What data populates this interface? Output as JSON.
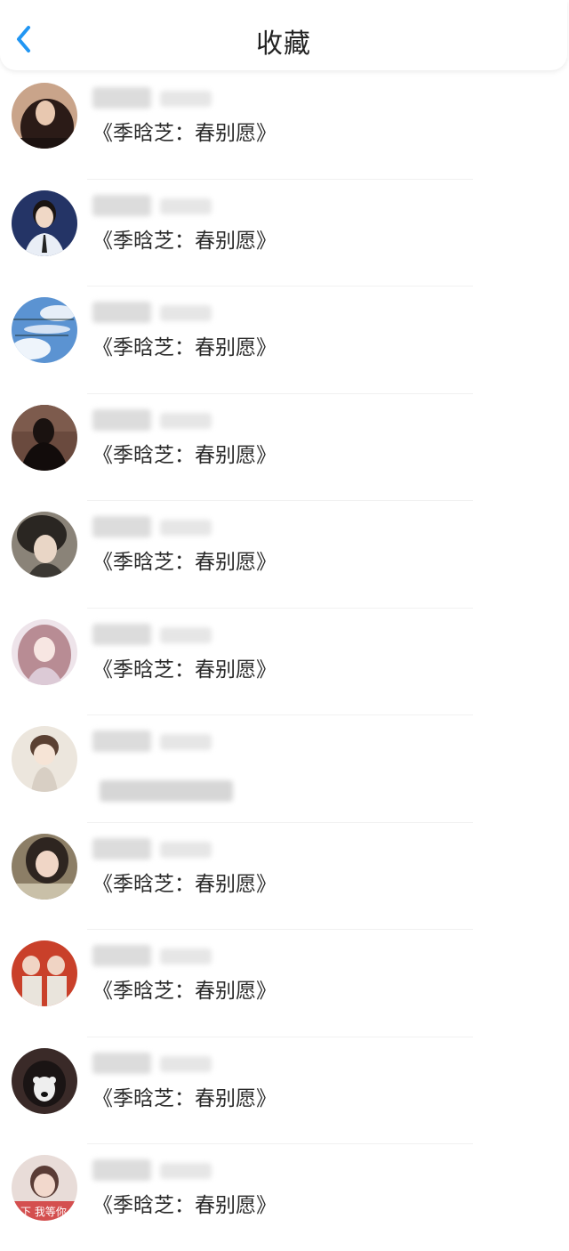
{
  "header": {
    "title": "收藏",
    "back_icon": "chevron-left-icon",
    "accent": "#2196f3"
  },
  "favorites": [
    {
      "work": "《季晗芝：春别愿》"
    },
    {
      "work": "《季晗芝：春别愿》"
    },
    {
      "work": "《季晗芝：春别愿》"
    },
    {
      "work": "《季晗芝：春别愿》"
    },
    {
      "work": "《季晗芝：春别愿》"
    },
    {
      "work": "《季晗芝：春别愿》"
    },
    {
      "work": ""
    },
    {
      "work": "《季晗芝：春别愿》"
    },
    {
      "work": "《季晗芝：春别愿》"
    },
    {
      "work": "《季晗芝：春别愿》"
    },
    {
      "work": "《季晗芝：春别愿》"
    }
  ],
  "avatar_colors": [
    "#3a2522",
    "#1e2a55",
    "#4f88c8",
    "#2a1c1a",
    "#3d3a36",
    "#c9a6b0",
    "#e8ddd2",
    "#6b5a4a",
    "#c8402a",
    "#2c2222",
    "#d46060"
  ],
  "avatar_caption_last": "下 我等你"
}
